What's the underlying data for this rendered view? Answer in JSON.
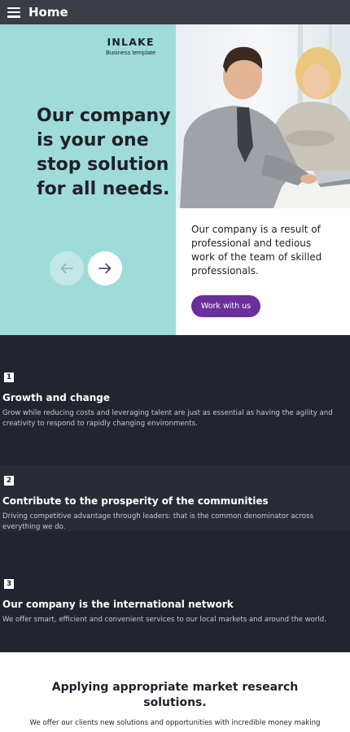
{
  "header": {
    "title": "Home",
    "menu_icon": "hamburger-menu-icon"
  },
  "brand": {
    "name": "INLAKE",
    "tagline": "Business template"
  },
  "hero": {
    "heading": "Our company is your one stop solution for all needs.",
    "description": "Our company is a result of professional and tedious work of the team of skilled professionals.",
    "cta_label": "Work with us",
    "prev_icon": "arrow-left-icon",
    "next_icon": "arrow-right-icon"
  },
  "features": [
    {
      "number": "1",
      "title": "Growth and change",
      "text": "Grow while reducing costs and leveraging talent are just as essential as having the agility and creativity to respond to rapidly changing environments."
    },
    {
      "number": "2",
      "title": "Contribute to the prosperity of the communities",
      "text": "Driving competitive advantage through leaders: that is the common denominator across everything we do."
    },
    {
      "number": "3",
      "title": "Our company is the international network",
      "text": "We offer smart, efficient and convenient services to our local markets and around the world."
    }
  ],
  "section": {
    "heading": "Applying appropriate market research solutions.",
    "text": "We offer our clients new solutions and opportunities with incredible money making"
  },
  "colors": {
    "topbar": "#3a3c46",
    "hero_teal": "#9fdcd9",
    "accent_purple": "#6a2f9a",
    "dark_section": "#22242e"
  }
}
